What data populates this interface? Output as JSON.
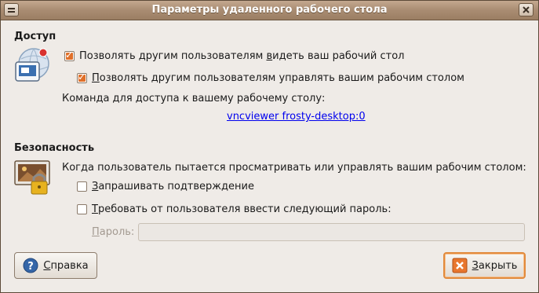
{
  "window": {
    "title": "Параметры удаленного рабочего стола"
  },
  "access": {
    "heading": "Доступ",
    "allow_view": {
      "pre": "Позволять другим пользователям ",
      "accel": "в",
      "post": "идеть ваш рабочий стол",
      "checked": true
    },
    "allow_control": {
      "pre": "",
      "accel": "П",
      "post": "озволять другим пользователям управлять вашим рабочим столом",
      "checked": true
    },
    "command_label": "Команда для доступа к вашему рабочему столу:",
    "command_link": "vncviewer frosty-desktop:0"
  },
  "security": {
    "heading": "Безопасность",
    "description": "Когда пользователь пытается просматривать или управлять вашим рабочим столом:",
    "ask_confirm": {
      "accel": "З",
      "post": "апрашивать подтверждение",
      "checked": false
    },
    "require_password": {
      "accel": "Т",
      "post": "ребовать от пользователя ввести следующий пароль:",
      "checked": false
    },
    "password_label": {
      "accel": "П",
      "post": "ароль:"
    },
    "password_value": ""
  },
  "buttons": {
    "help": {
      "accel": "С",
      "post": "правка",
      "icon": "help-icon"
    },
    "close": {
      "accel": "З",
      "post": "акрыть",
      "icon": "close-x-icon"
    }
  },
  "colors": {
    "accent": "#e0702a",
    "titlebar": "#a98c72",
    "link": "#0000ee"
  }
}
